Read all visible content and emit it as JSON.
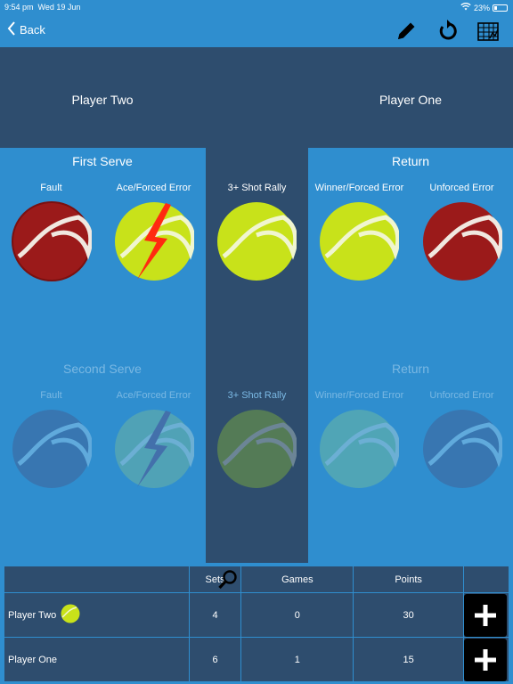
{
  "status_bar": {
    "time": "9:54 pm",
    "date": "Wed 19 Jun",
    "battery": "23%"
  },
  "nav": {
    "back_label": "Back"
  },
  "header": {
    "left_player": "Player Two",
    "right_player": "Player One"
  },
  "first_serve": {
    "title": "First Serve",
    "labels": [
      "Fault",
      "Ace/Forced Error"
    ]
  },
  "first_return": {
    "title": "Return",
    "labels": [
      "Winner/Forced Error",
      "Unforced Error"
    ]
  },
  "rally_label": "3+ Shot Rally",
  "second_serve": {
    "title": "Second Serve",
    "labels": [
      "Fault",
      "Ace/Forced Error"
    ]
  },
  "second_return": {
    "title": "Return",
    "labels": [
      "Winner/Forced Error",
      "Unforced Error"
    ]
  },
  "scoreboard": {
    "headers": {
      "sets": "Sets",
      "games": "Games",
      "points": "Points"
    },
    "rows": [
      {
        "name": "Player Two",
        "sets": "4",
        "games": "0",
        "points": "30"
      },
      {
        "name": "Player One",
        "sets": "6",
        "games": "1",
        "points": "15"
      }
    ]
  },
  "colors": {
    "bg": "#2f8ecf",
    "panel": "#2e4d6e",
    "yellow_ball": "#c8e21a",
    "red_ball": "#9b1a1a",
    "accent_bolt": "#ff2a10"
  }
}
